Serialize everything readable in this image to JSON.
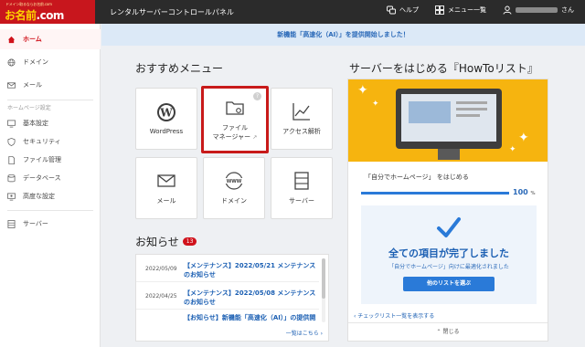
{
  "brand": {
    "tagline": "ドメイン取るならお名前.com",
    "logo_main": "お名前",
    "logo_dot": ".com"
  },
  "topbar": {
    "title": "レンタルサーバーコントロールパネル",
    "help": "ヘルプ",
    "menu": "メニュー一覧",
    "user_suffix": "さん"
  },
  "sidebar": {
    "home": "ホーム",
    "domain": "ドメイン",
    "mail": "メール",
    "group_label": "ホームページ設定",
    "basic": "基本設定",
    "security": "セキュリティ",
    "file_mgmt": "ファイル管理",
    "database": "データベース",
    "advanced": "高度な設定",
    "server": "サーバー"
  },
  "notice": "新機能「高速化（AI）」を提供開始しました！",
  "recommend": {
    "title": "おすすめメニュー",
    "wordpress": "WordPress",
    "file_manager_1": "ファイル",
    "file_manager_2": "マネージャー",
    "access": "アクセス解析",
    "mail": "メール",
    "domain": "ドメイン",
    "server": "サーバー"
  },
  "news": {
    "title": "お知らせ",
    "count": "13",
    "items": [
      {
        "date": "2022/05/09",
        "text": "【メンテナンス】2022/05/21 メンテナンスのお知らせ"
      },
      {
        "date": "2022/04/25",
        "text": "【メンテナンス】2022/05/08 メンテナンスのお知らせ"
      },
      {
        "date": "",
        "text": "【お知らせ】新機能「高速化（AI）」の提供開"
      }
    ],
    "more": "一覧はこちら ›"
  },
  "howto": {
    "title": "サーバーをはじめる『HowToリスト』",
    "subtitle_quote": "「自分でホームページ」",
    "subtitle_rest": "をはじめる",
    "progress": 100,
    "progress_label": "100",
    "pct_sign": "%",
    "complete_title": "全ての項目が完了しました",
    "complete_sub": "「自分でホームページ」向けに最適化されました",
    "other_button": "他のリストを選ぶ",
    "checklist_link": "‹ チェックリスト一覧を表示する",
    "close": "閉じる"
  },
  "colors": {
    "brand_red": "#c8161d",
    "accent_blue": "#2a7ad8",
    "hero_yellow": "#f6b40f"
  }
}
